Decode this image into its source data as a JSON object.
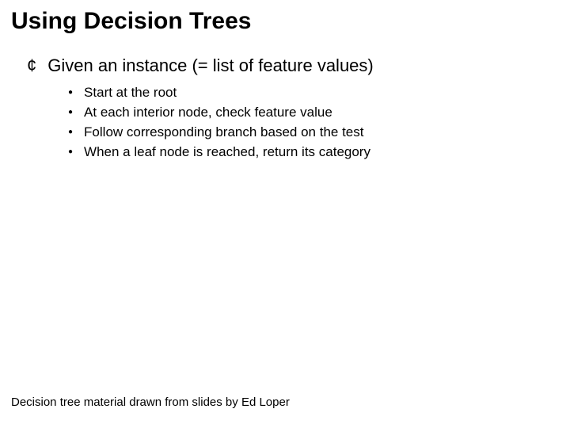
{
  "title": "Using Decision Trees",
  "main": {
    "bullet_glyph": "¢",
    "text": "Given an instance (= list of feature values)",
    "sub_glyph": "●",
    "items": [
      "Start at the root",
      "At each interior node, check feature value",
      "Follow corresponding branch based on the test",
      "When a leaf node is reached, return its category"
    ]
  },
  "footnote": "Decision tree material drawn from slides by Ed Loper"
}
